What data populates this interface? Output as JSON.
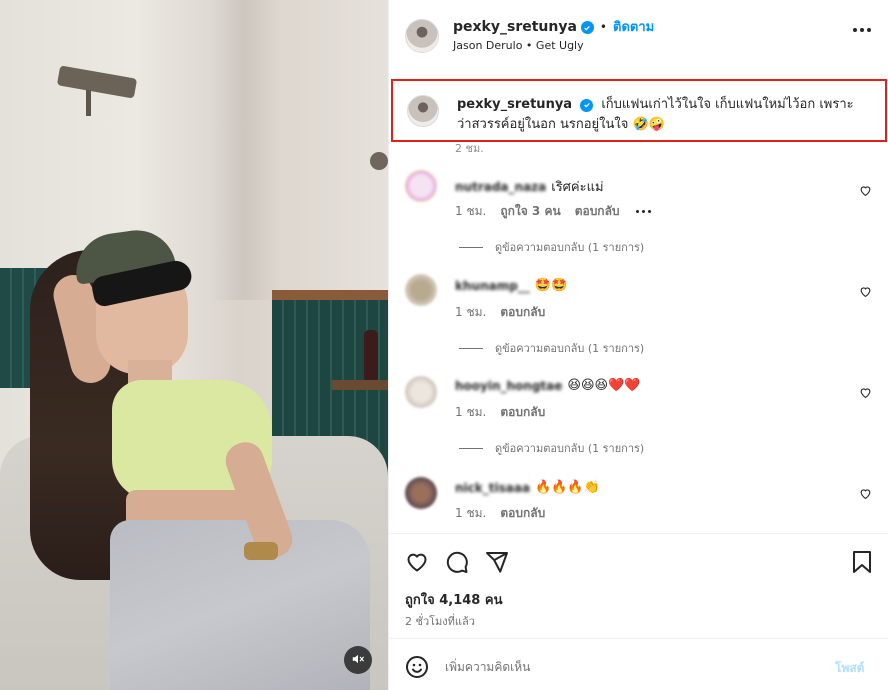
{
  "post": {
    "username": "pexky_sretunya",
    "follow_label": "ติดตาม",
    "separator": "•",
    "audio": "Jason Derulo • Get Ugly",
    "more_icon": "more-horizontal-icon"
  },
  "caption": {
    "username": "pexky_sretunya",
    "text": "เก็บแฟนเก่าไว้ในใจ เก็บแฟนใหม่ไว้อก เพราะว่าสวรรค์อยู่ในอก นรกอยู่ในใจ 🤣🤪",
    "time": "2 ชม."
  },
  "comments": [
    {
      "username": "nutrada_naza",
      "text": "เริศค่ะแม่",
      "time": "1 ชม.",
      "likes": "ถูกใจ 3 คน",
      "reply_label": "ตอบกลับ",
      "replies": "ดูข้อความตอบกลับ (1 รายการ)",
      "avatar_color": "#f0d3f0"
    },
    {
      "username": "khunamp__",
      "text": "🤩🤩",
      "time": "1 ชม.",
      "likes": "",
      "reply_label": "ตอบกลับ",
      "replies": "ดูข้อความตอบกลับ (1 รายการ)",
      "avatar_color": "#c7b9a6"
    },
    {
      "username": "hooyin_hongtae",
      "text": "😆😆😆❤️❤️",
      "time": "1 ชม.",
      "likes": "",
      "reply_label": "ตอบกลับ",
      "replies": "ดูข้อความตอบกลับ (1 รายการ)",
      "avatar_color": "#ddd2c6"
    },
    {
      "username": "nick_tisaaa",
      "text": "🔥🔥🔥👏",
      "time": "1 ชม.",
      "likes": "",
      "reply_label": "ตอบกลับ",
      "replies": "",
      "avatar_color": "#8a6a5c"
    }
  ],
  "actions": {
    "likes": "ถูกใจ 4,148 คน",
    "time_ago": "2 ชั่วโมงที่แล้ว"
  },
  "comment_box": {
    "placeholder": "เพิ่มความคิดเห็น",
    "post_label": "โพสต์"
  },
  "colors": {
    "accent": "#0095f6",
    "highlight_border": "#e0201b",
    "muted_text": "#737373"
  }
}
